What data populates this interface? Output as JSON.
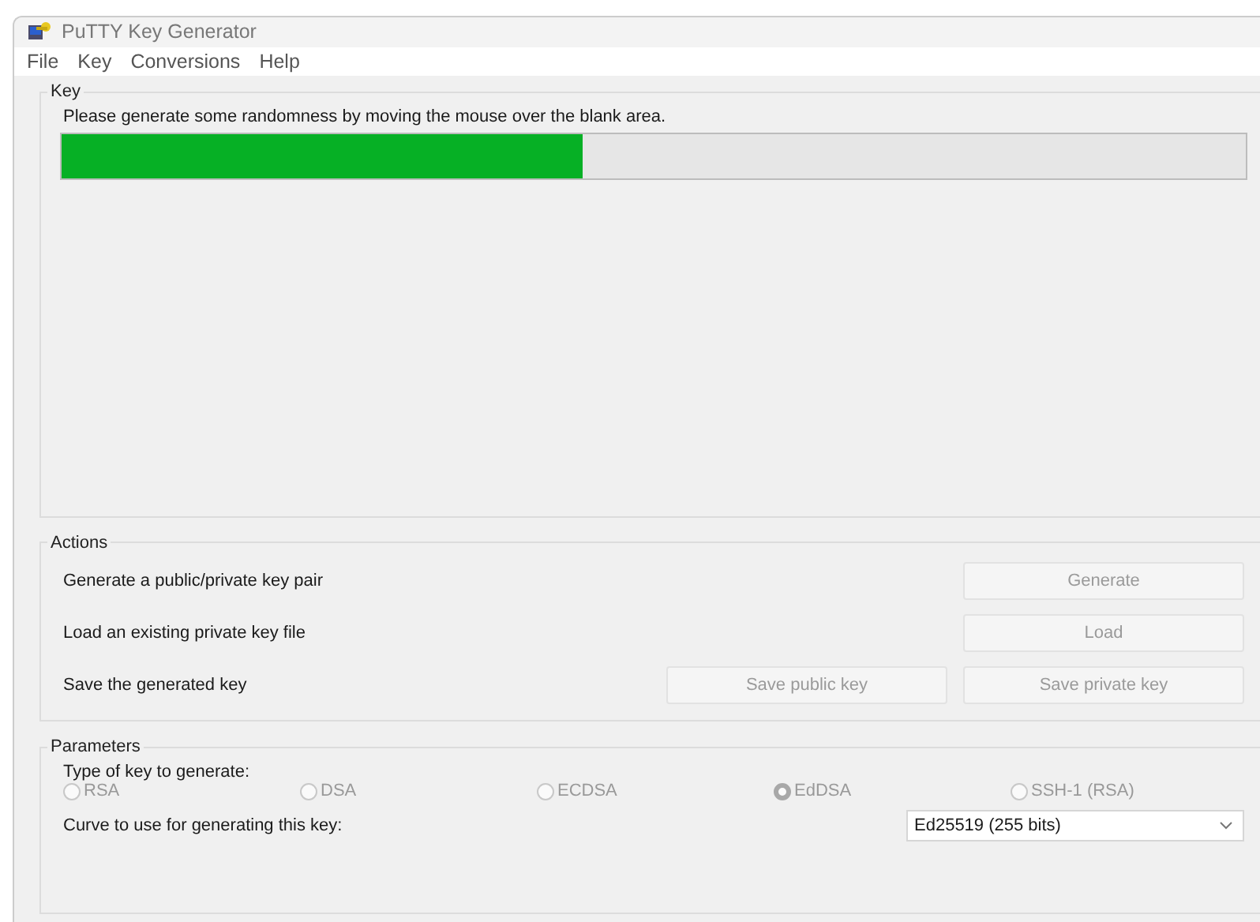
{
  "window": {
    "title": "PuTTY Key Generator"
  },
  "menu": [
    "File",
    "Key",
    "Conversions",
    "Help"
  ],
  "key_group": {
    "title": "Key",
    "message": "Please generate some randomness by moving the mouse over the blank area.",
    "progress": {
      "level": 0.44
    }
  },
  "actions": {
    "title": "Actions",
    "rows": [
      {
        "label": "Generate a public/private key pair",
        "buttons": [
          {
            "label": "Generate",
            "disabled": true
          }
        ]
      },
      {
        "label": "Load an existing private key file",
        "buttons": [
          {
            "label": "Load",
            "disabled": true
          }
        ]
      },
      {
        "label": "Save the generated key",
        "buttons": [
          {
            "label": "Save public key",
            "disabled": true
          },
          {
            "label": "Save private key",
            "disabled": true
          }
        ]
      }
    ]
  },
  "parameters": {
    "title": "Parameters",
    "type_label": "Type of key to generate:",
    "key_types": [
      {
        "label": "RSA",
        "selected": false,
        "disabled": true
      },
      {
        "label": "DSA",
        "selected": false,
        "disabled": true
      },
      {
        "label": "ECDSA",
        "selected": false,
        "disabled": true
      },
      {
        "label": "EdDSA",
        "selected": true,
        "disabled": true
      },
      {
        "label": "SSH-1 (RSA)",
        "selected": false,
        "disabled": true
      }
    ],
    "curve_label": "Curve to use for generating this key:",
    "curve_value": "Ed25519 (255 bits)"
  }
}
